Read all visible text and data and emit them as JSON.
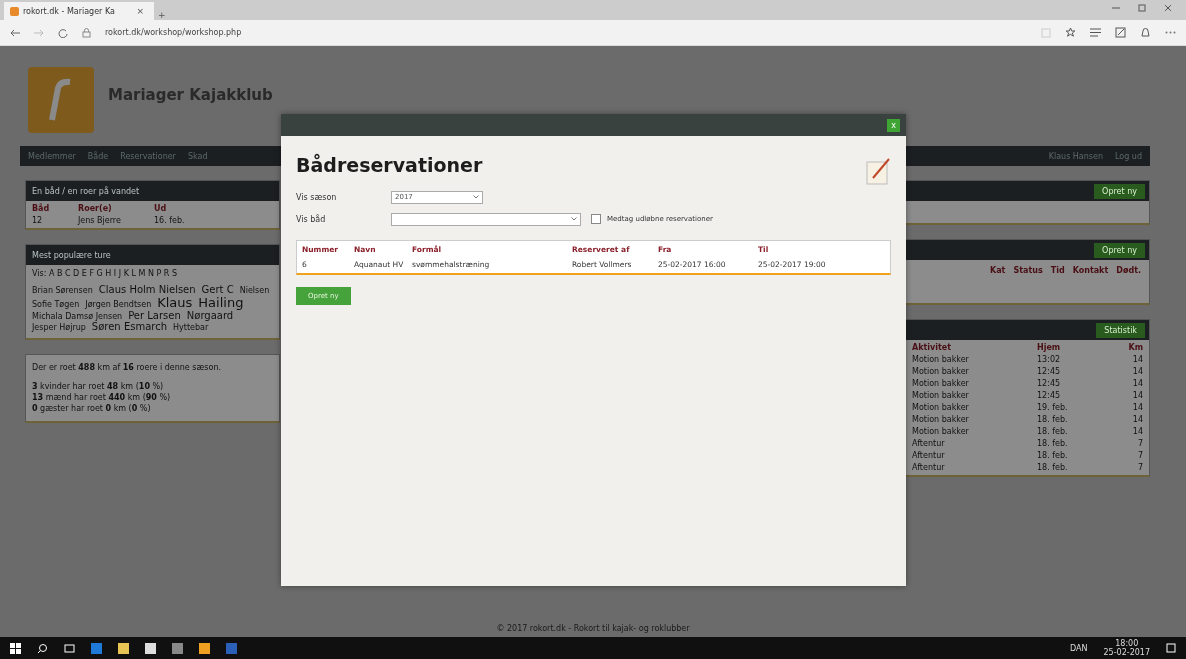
{
  "browser": {
    "tab": {
      "title": "rokort.dk - Mariager Ka",
      "close": "×",
      "new": "+"
    },
    "address": "rokort.dk/workshop/workshop.php"
  },
  "site": {
    "title": "Mariager Kajakklub",
    "nav": [
      "Medlemmer",
      "Både",
      "Reservationer",
      "Skad"
    ],
    "user": "Klaus Hansen",
    "logout": "Log ud"
  },
  "left_panels": [
    {
      "kind": "table",
      "title": "En båd / en roer på vandet",
      "columns": [
        "Båd",
        "Roer(e)",
        "Ud"
      ],
      "rows": [
        [
          "12",
          "Jens Bjerre",
          "16. feb."
        ]
      ]
    },
    {
      "kind": "cloud",
      "title": "Mest populære ture",
      "letters": "Vis: A B C D E F G H I J K L M N P R S",
      "names": [
        {
          "text": "Brian Sørensen",
          "kind": "small"
        },
        {
          "text": "Claus Holm Nielsen",
          "kind": "medium"
        },
        {
          "text": "Gert C",
          "kind": "medium"
        },
        {
          "text": "Nielsen",
          "kind": "small"
        },
        {
          "text": "Sofie Tøgen",
          "kind": "small"
        },
        {
          "text": "Jørgen Bendtsen",
          "kind": "small"
        },
        {
          "text": "Klaus",
          "kind": "large"
        },
        {
          "text": "Hailing",
          "kind": "large"
        },
        {
          "text": "Michala Damsø Jensen",
          "kind": "small"
        },
        {
          "text": "Per Larsen",
          "kind": "medium"
        },
        {
          "text": "Nørgaard",
          "kind": "medium"
        },
        {
          "text": "Jesper Højrup",
          "kind": "small"
        },
        {
          "text": "Søren Esmarch",
          "kind": "medium"
        },
        {
          "text": "Hyttebar",
          "kind": "small"
        }
      ]
    },
    {
      "kind": "stats",
      "lines": [
        "Der er roet **488** km af **16** roere i denne sæson.",
        "**3** kvinder har roet **48** km (**10** %)",
        "**13** mænd har roet **440** km (**90** %)",
        "**0** gæster har roet **0** km (**0** %)"
      ]
    }
  ],
  "right_panels": [
    {
      "kind": "plain",
      "button": "Opret ny"
    },
    {
      "kind": "heads",
      "button": "Opret ny",
      "columns": [
        "Kat",
        "Status",
        "Tid",
        "Kontakt",
        "Dødt."
      ]
    },
    {
      "kind": "table",
      "button": "Statistik",
      "columns": [
        "Aktivitet",
        "Hjem",
        "Km"
      ],
      "rows": [
        [
          "Motion bakker",
          "13:02",
          "14"
        ],
        [
          "Motion bakker",
          "12:45",
          "14"
        ],
        [
          "Motion bakker",
          "12:45",
          "14"
        ],
        [
          "Motion bakker",
          "12:45",
          "14"
        ],
        [
          "Motion bakker",
          "19. feb.",
          "14"
        ],
        [
          "Motion bakker",
          "18. feb.",
          "14"
        ],
        [
          "Motion bakker",
          "18. feb.",
          "14"
        ],
        [
          "Aftentur",
          "18. feb.",
          "7"
        ],
        [
          "Aftentur",
          "18. feb.",
          "7"
        ],
        [
          "Aftentur",
          "18. feb.",
          "7"
        ]
      ]
    }
  ],
  "footer": "© 2017 rokort.dk - Rokort til kajak- og roklubber",
  "modal": {
    "close": "x",
    "title": "Bådreservationer",
    "season_label": "Vis sæson",
    "season": "2017",
    "boat_label": "Vis båd",
    "include_expired": {
      "label": "Medtag udløbne reservationer",
      "checked": false
    },
    "columns": [
      "Nummer",
      "Navn",
      "Formål",
      "Reserveret af",
      "Fra",
      "Til"
    ],
    "rows": [
      [
        "6",
        "Aquanaut HV",
        "svømmehalstræning",
        "Robert Vollmers",
        "25-02-2017 16:00",
        "25-02-2017 19:00"
      ]
    ],
    "button": "Opret ny"
  },
  "taskbar": {
    "language": "DAN",
    "time": "18:00",
    "date": "25-02-2017"
  }
}
